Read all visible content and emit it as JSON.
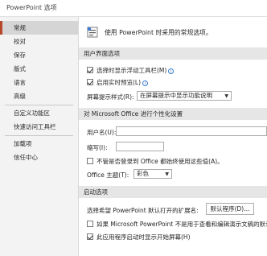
{
  "window": {
    "title": "PowerPoint 选项"
  },
  "sidebar": {
    "items": [
      {
        "label": "常规",
        "active": true
      },
      {
        "label": "校对"
      },
      {
        "label": "保存"
      },
      {
        "label": "版式"
      },
      {
        "label": "语言"
      },
      {
        "label": "高级"
      },
      {
        "label": "自定义功能区"
      },
      {
        "label": "快速访问工具栏"
      },
      {
        "label": "加载项"
      },
      {
        "label": "信任中心"
      }
    ]
  },
  "main": {
    "intro_text": "使用 PowerPoint 时采用的常规选项。",
    "ui_section": {
      "title": "用户界面选项",
      "show_mini_toolbar": "选择时显示浮动工具栏(M)",
      "show_mini_toolbar_checked": true,
      "live_preview": "启用实时预览(L)",
      "live_preview_checked": true,
      "screentip_label": "屏幕提示样式(R):",
      "screentip_value": "在屏幕提示中显示功能说明"
    },
    "personalize_section": {
      "title": "对 Microsoft Office 进行个性化设置",
      "username_label": "用户名(U):",
      "username_value": "",
      "initials_label": "缩写(I):",
      "initials_value": "",
      "always_use_label": "不管是否登录到 Office 都始终使用这些值(A)。",
      "always_use_checked": false,
      "theme_label": "Office 主题(T):",
      "theme_value": "彩色"
    },
    "startup_section": {
      "title": "启动选项",
      "default_ext_label": "选择希望 PowerPoint 默认打开的扩展名:",
      "default_programs_button": "默认程序(D)...",
      "not_default_label": "如果 Microsoft PowerPoint 不是用于查看和编辑演示文稿的默认",
      "not_default_checked": false,
      "show_start_screen_label": "此应用程序启动时显示开始屏幕(H)",
      "show_start_screen_checked": true
    }
  },
  "colors": {
    "accent": "#b7472a",
    "info": "#3b7bd4",
    "section_bg": "#e6e6e6"
  }
}
